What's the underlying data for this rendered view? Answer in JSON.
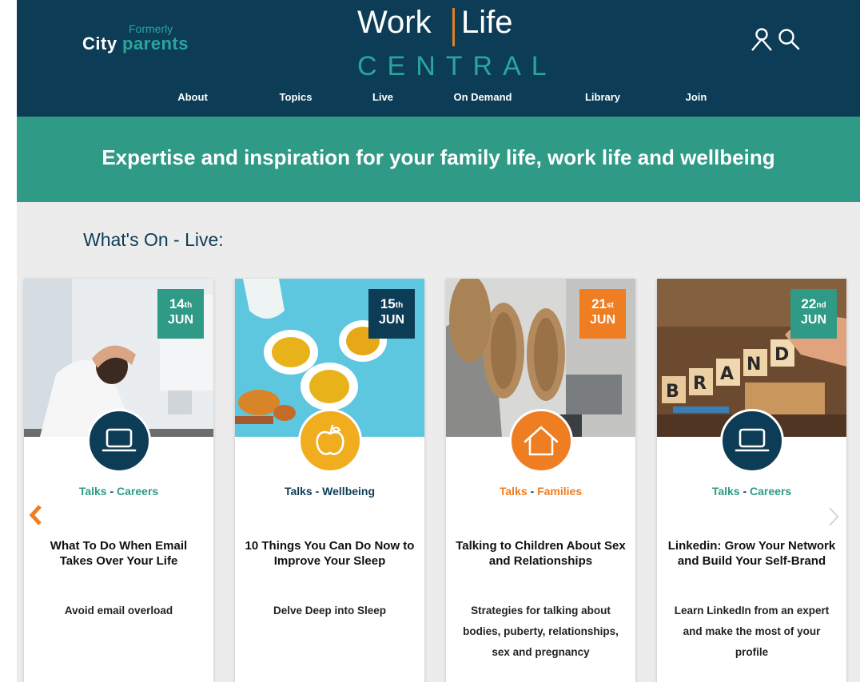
{
  "header": {
    "logo": {
      "formerly": "Formerly",
      "city": "City",
      "parents": "parents"
    },
    "brand": {
      "work": "Work",
      "life": "Life",
      "central": "CENTRAL"
    },
    "icons": [
      "user-icon",
      "search-icon"
    ],
    "nav": [
      "About",
      "Topics",
      "Live",
      "On Demand",
      "Library",
      "Join"
    ]
  },
  "banner": {
    "tagline": "Expertise and inspiration for your family life, work life and wellbeing"
  },
  "section": {
    "title": "What's On - Live:"
  },
  "cards": [
    {
      "day": "14",
      "suffix": "th",
      "month": "JUN",
      "badge_color": "#2f9a86",
      "icon": "laptop-icon",
      "icon_color": "#0d3d56",
      "category_type": "Talks",
      "category_sep": " - ",
      "category_topic": "Careers",
      "category_color": "#2f9a86",
      "title": "What To Do When Email Takes Over Your Life",
      "description": "Avoid email overload"
    },
    {
      "day": "15",
      "suffix": "th",
      "month": "JUN",
      "badge_color": "#0d3d56",
      "icon": "apple-icon",
      "icon_color": "#f0ad1e",
      "category_type": "Talks",
      "category_sep": " - ",
      "category_topic": "Wellbeing",
      "category_color": "#0d3d56",
      "title": "10 Things You Can Do Now to Improve Your Sleep",
      "description": "Delve Deep into Sleep"
    },
    {
      "day": "21",
      "suffix": "st",
      "month": "JUN",
      "badge_color": "#ef7d22",
      "icon": "house-icon",
      "icon_color": "#ef7d22",
      "category_type": "Talks",
      "category_sep": " - ",
      "category_topic": "Families",
      "category_color": "#ef7d22",
      "title": "Talking to Children About Sex and Relationships",
      "description": "Strategies for talking about bodies, puberty, relationships, sex and pregnancy"
    },
    {
      "day": "22",
      "suffix": "nd",
      "month": "JUN",
      "badge_color": "#2f9a86",
      "icon": "laptop-icon",
      "icon_color": "#0d3d56",
      "category_type": "Talks",
      "category_sep": " - ",
      "category_topic": "Careers",
      "category_color": "#2f9a86",
      "title": "Linkedin: Grow Your Network and Build Your Self-Brand",
      "description": "Learn LinkedIn from an expert and make the most of your profile"
    }
  ],
  "carousel": {
    "prev_icon": "chevron-left-icon",
    "next_icon": "chevron-right-icon",
    "prev_color": "#ef7d22",
    "next_color": "#cccccc"
  }
}
